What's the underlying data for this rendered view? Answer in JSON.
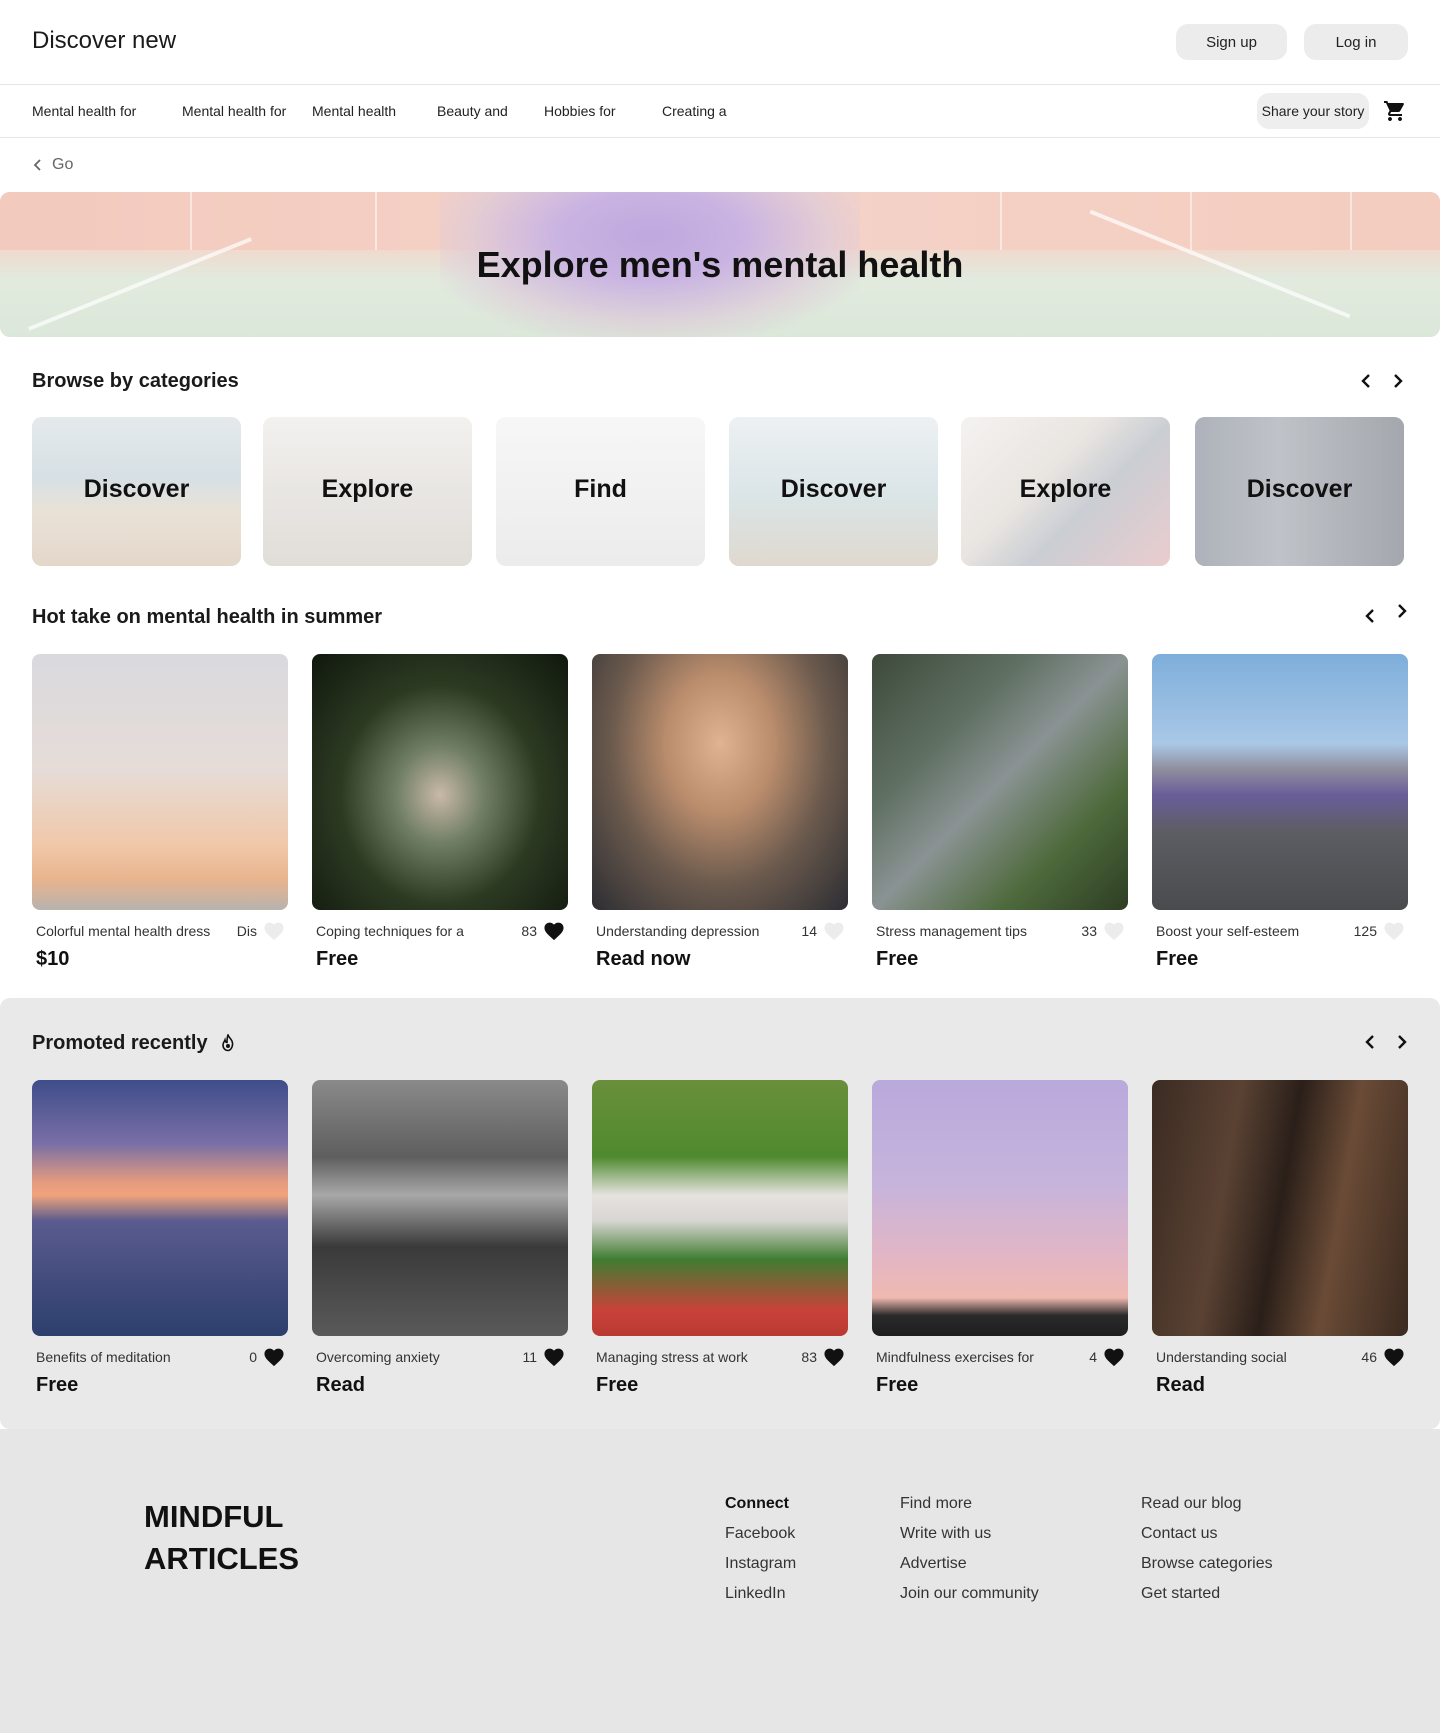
{
  "header": {
    "brand": "Discover new",
    "signup_label": "Sign up",
    "login_label": "Log in"
  },
  "nav": {
    "items": [
      "Mental health for",
      "Mental health for",
      "Mental health",
      "Beauty and",
      "Hobbies for",
      "Creating a"
    ],
    "share_label": "Share your story",
    "cart_icon": "cart-icon"
  },
  "back": {
    "label": "Go"
  },
  "hero": {
    "title": "Explore men's mental health"
  },
  "categories": {
    "title": "Browse by categories",
    "items": [
      "Discover",
      "Explore",
      "Find",
      "Discover",
      "Explore",
      "Discover"
    ]
  },
  "hot": {
    "title": "Hot take on mental health in summer",
    "cards": [
      {
        "title": "Colorful mental health dress",
        "count": "Dis",
        "price": "$10",
        "liked": false
      },
      {
        "title": "Coping techniques for a",
        "count": "83",
        "price": "Free",
        "liked": true
      },
      {
        "title": "Understanding depression",
        "count": "14",
        "price": "Read now",
        "liked": false
      },
      {
        "title": "Stress management tips",
        "count": "33",
        "price": "Free",
        "liked": false
      },
      {
        "title": "Boost your self-esteem",
        "count": "125",
        "price": "Free",
        "liked": false
      }
    ]
  },
  "promoted": {
    "title": "Promoted recently",
    "icon": "fire-icon",
    "cards": [
      {
        "title": "Benefits of meditation",
        "count": "0",
        "price": "Free",
        "liked": true
      },
      {
        "title": "Overcoming anxiety",
        "count": "11",
        "price": "Read",
        "liked": true
      },
      {
        "title": "Managing stress at work",
        "count": "83",
        "price": "Free",
        "liked": true
      },
      {
        "title": "Mindfulness exercises for",
        "count": "4",
        "price": "Free",
        "liked": true
      },
      {
        "title": "Understanding social",
        "count": "46",
        "price": "Read",
        "liked": true
      }
    ]
  },
  "footer": {
    "brand_line1": "MINDFUL",
    "brand_line2": "ARTICLES",
    "col1": [
      "Connect",
      "Facebook",
      "Instagram",
      "LinkedIn"
    ],
    "col2": [
      "Find more",
      "Write with us",
      "Advertise",
      "Join our community"
    ],
    "col3": [
      "Read our blog",
      "Contact us",
      "Browse categories",
      "Get started"
    ]
  }
}
